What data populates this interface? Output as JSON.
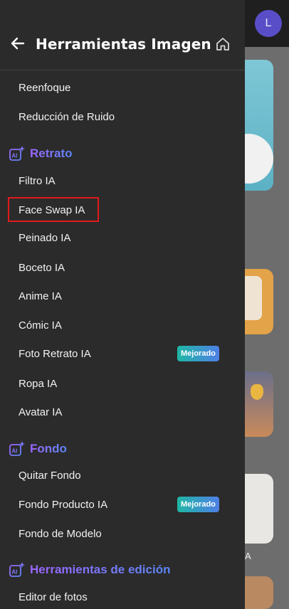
{
  "header": {
    "title": "Herramientas Imagen",
    "back_icon": "arrow-left-icon",
    "home_icon": "home-icon"
  },
  "background": {
    "avatar_letter": "L",
    "side_letter": "A"
  },
  "menu": {
    "items_top": [
      "Reenfoque",
      "Reducción de Ruido"
    ],
    "section_retrato": "Retrato",
    "retrato_items": [
      "Filtro IA",
      "Face Swap IA",
      "Peinado IA",
      "Boceto IA",
      "Anime IA",
      "Cómic IA",
      "Foto Retrato IA",
      "Ropa IA",
      "Avatar IA"
    ],
    "section_fondo": "Fondo",
    "fondo_items": [
      "Quitar Fondo",
      "Fondo Producto IA",
      "Fondo de Modelo"
    ],
    "section_edicion": "Herramientas de edición",
    "edicion_items": [
      "Editor de fotos"
    ],
    "badge_label": "Mejorado",
    "highlighted_item": "Face Swap IA"
  },
  "colors": {
    "drawer_bg": "#2b2b2b",
    "section_gradient_start": "#9c66ff",
    "section_gradient_end": "#5c86f6",
    "badge_gradient_start": "#1fb7a5",
    "badge_gradient_end": "#4f7fe6",
    "highlight_border": "#e2191c"
  }
}
